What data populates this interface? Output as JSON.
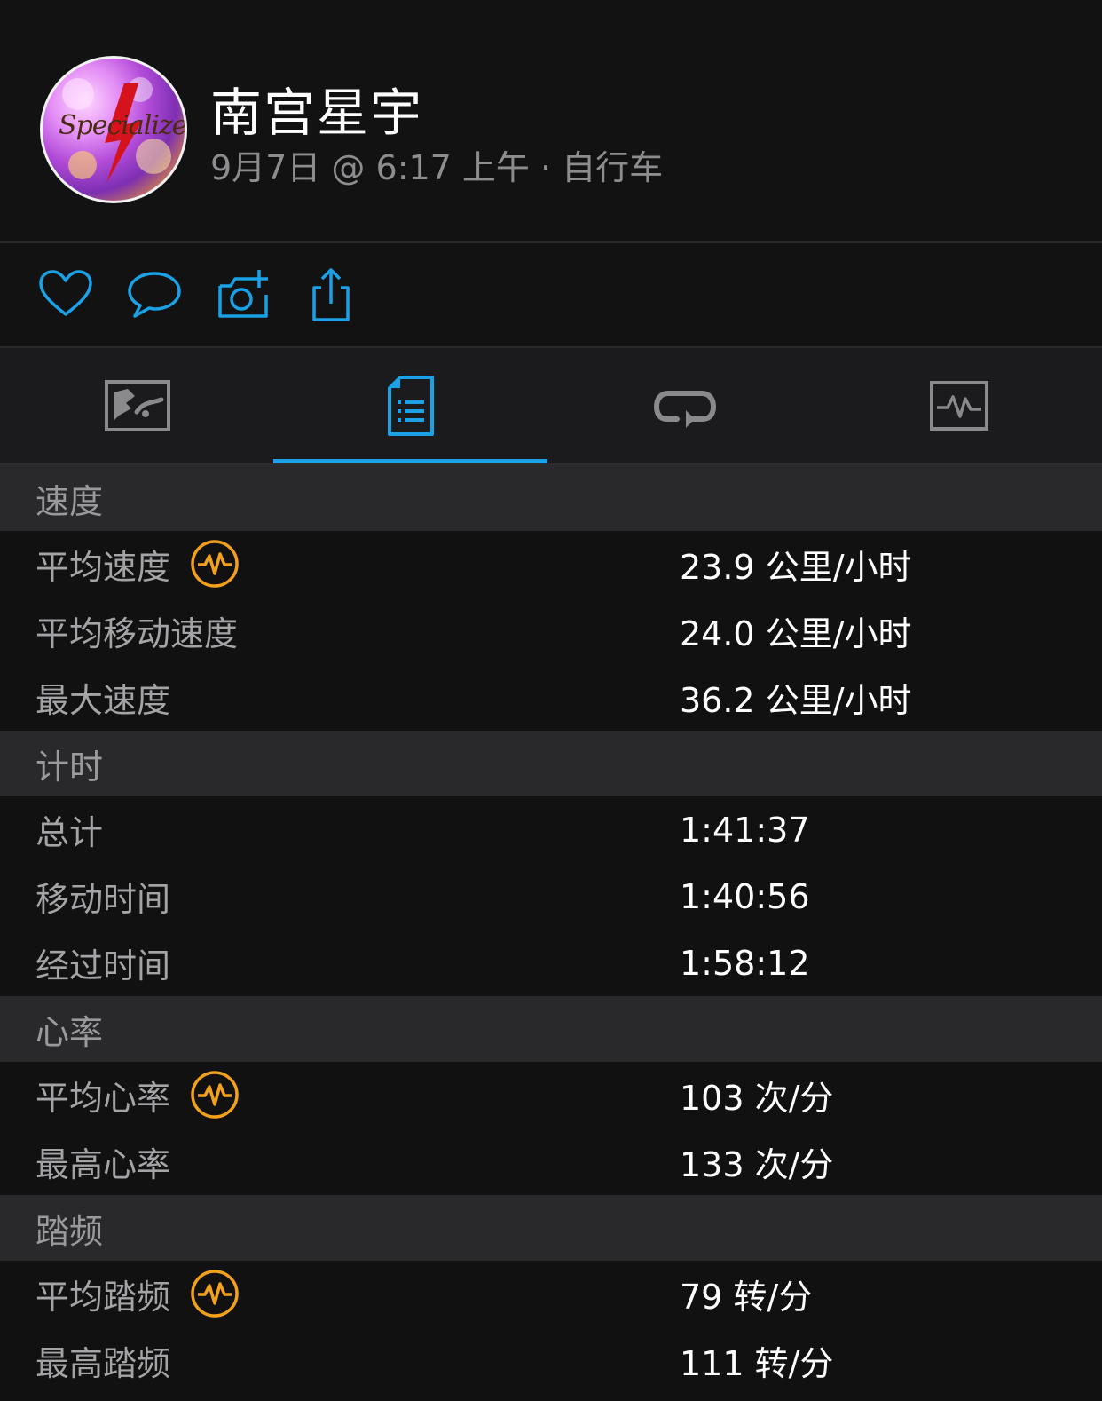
{
  "header": {
    "avatar_text": "Specialized",
    "user_name": "南宫星宇",
    "meta": "9月7日 @ 6:17 上午 · 自行车"
  },
  "actions": {
    "icons": [
      "heart-icon",
      "comment-icon",
      "add-photo-icon",
      "share-icon"
    ]
  },
  "tabs": {
    "items": [
      "map-icon",
      "stats-list-icon",
      "laps-icon",
      "chart-icon"
    ],
    "selected_index": 1
  },
  "colors": {
    "accent_blue": "#1aa1e6",
    "badge_orange": "#f3a11b",
    "section_bg": "#29292b",
    "row_bg": "#111112"
  },
  "sections": {
    "speed": {
      "title": "速度",
      "rows": [
        {
          "label": "平均速度",
          "value": "23.9 公里/小时",
          "badge": true
        },
        {
          "label": "平均移动速度",
          "value": "24.0 公里/小时"
        },
        {
          "label": "最大速度",
          "value": "36.2 公里/小时"
        }
      ]
    },
    "timing": {
      "title": "计时",
      "rows": [
        {
          "label": "总计",
          "value": "1:41:37"
        },
        {
          "label": "移动时间",
          "value": "1:40:56"
        },
        {
          "label": "经过时间",
          "value": "1:58:12"
        }
      ]
    },
    "heart": {
      "title": "心率",
      "rows": [
        {
          "label": "平均心率",
          "value": "103 次/分",
          "badge": true
        },
        {
          "label": "最高心率",
          "value": "133 次/分"
        }
      ]
    },
    "cadence": {
      "title": "踏频",
      "rows": [
        {
          "label": "平均踏频",
          "value": "79 转/分",
          "badge": true
        },
        {
          "label": "最高踏频",
          "value": "111 转/分"
        }
      ]
    }
  }
}
